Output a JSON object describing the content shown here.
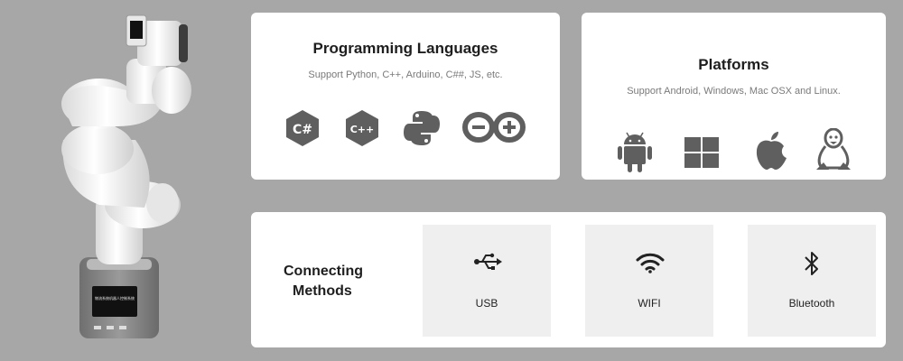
{
  "robot": {
    "screen_text": "物流系统机器人控制系统",
    "button_labels": [
      "",
      "",
      ""
    ]
  },
  "languages": {
    "title": "Programming Languages",
    "subtitle": "Support Python, C++, Arduino, C##, JS, etc.",
    "icons": [
      "csharp-icon",
      "cplusplus-icon",
      "python-icon",
      "arduino-icon"
    ],
    "csharp_glyph": "C#",
    "cpp_glyph": "C++"
  },
  "platforms": {
    "title": "Platforms",
    "subtitle": "Support Android, Windows, Mac OSX and Linux.",
    "icons": [
      "android-icon",
      "windows-icon",
      "apple-icon",
      "linux-icon"
    ]
  },
  "connecting": {
    "title_line1": "Connecting",
    "title_line2": "Methods",
    "methods": [
      {
        "label": "USB",
        "icon": "usb-icon"
      },
      {
        "label": "WIFI",
        "icon": "wifi-icon"
      },
      {
        "label": "Bluetooth",
        "icon": "bluetooth-icon"
      }
    ]
  },
  "colors": {
    "background": "#a7a7a7",
    "card": "#ffffff",
    "icon": "#5f5f5f",
    "method_tile": "#efefef"
  }
}
